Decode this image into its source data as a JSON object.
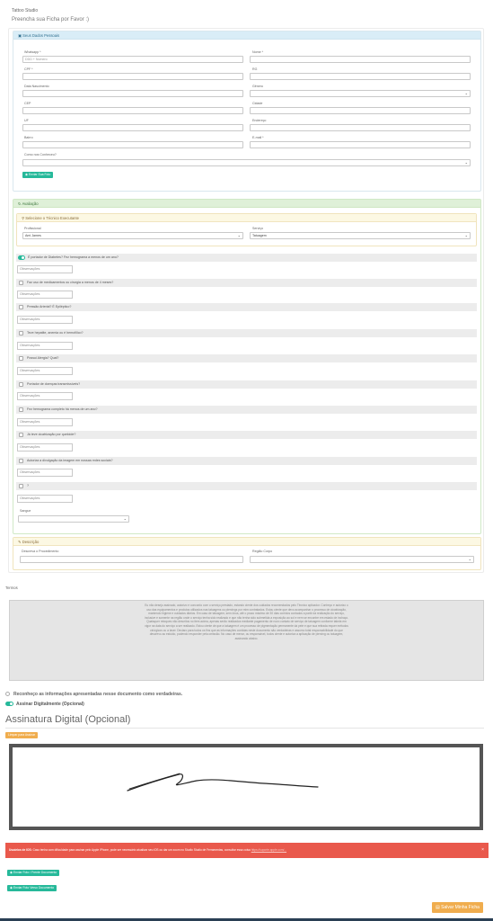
{
  "header": {
    "title": "Tattoo Studio",
    "subtitle": "Preencha sua Ficha por Favor :)"
  },
  "personal": {
    "heading": "Seus Dados Pessoais",
    "fields": {
      "whatsapp": {
        "label": "Whatsapp *",
        "placeholder": "DDD + Número"
      },
      "nome": {
        "label": "Nome *"
      },
      "cpf": {
        "label": "CPF *"
      },
      "rg": {
        "label": "RG"
      },
      "nascimento": {
        "label": "Data Nascimento"
      },
      "genero": {
        "label": "Gênero"
      },
      "cep": {
        "label": "CEP"
      },
      "cidade": {
        "label": "Cidade"
      },
      "uf": {
        "label": "UF"
      },
      "endereco": {
        "label": "Endereço"
      },
      "bairro": {
        "label": "Bairro"
      },
      "email": {
        "label": "E-mail *"
      },
      "conheceu": {
        "label": "Como nos Conheceu?"
      }
    },
    "send_photo": "Enviar Sua Foto"
  },
  "avaliacao": {
    "heading": "Avaliação",
    "sub_heading": "Selecione o Técnico Executante",
    "profissional": {
      "label": "Profissional",
      "value": "Ami James"
    },
    "servico": {
      "label": "Serviço",
      "value": "Tatuagem"
    },
    "obs_placeholder": "Observações",
    "questions": [
      "É portador de Diabetes? Fez hemograma a menos de um ano?",
      "Faz uso de medicamentos ou cirurgia a menos de 4 meses?",
      "Pressão Arterial? É Epiléptico?",
      "Teve hepatite, anemia ou é hemofílico?",
      "Possui Alergia? Qual?",
      "Portador de doenças transmissíveis?",
      "Fez hemograma completo há menos de um ano?",
      "Já teve cicatrização por queloide?",
      "Autoriza a divulgação da imagem em nossas redes sociais?",
      "?"
    ],
    "sangue": {
      "label": "Sangue"
    }
  },
  "descricao": {
    "heading": "Descrição",
    "desc_label": "Descreva o Procedimento",
    "regiao_label": "Região Corpo"
  },
  "termos": {
    "label": "Termos",
    "text": "Eu não desejo assinado, autorizo e concordo com o serviço prestado, estando ciente dos cuidados recomendados pelo Técnico aplicador. Conheço e autorizo o uso das equipamentos e produtos utilizados nas tatuagens ou piercings por mim contratados. Estou ciente que devo acompanhar o processo de cicatrização, mantendo higiene e cuidados diários. Em caso de tatuagem, sem ônus, até o prazo máximo de 30 dias corridos contados a partir da realização do serviço, inclusive e somente na região onde o serviço tenha sido realizado e que não tenha sido submetida a exposição ao sol e nem se encontre em estado de inchaço. Quaisquer retoques não descritos no item acima, apenas serão realizados mediante pagamento de novo contato de serviço de tatuagem conforme tabela em vigor na data do serviço a ser realizado. Estou ciente de que a tatuagem é um processo de pigmentação permanente da pele e que sua retirada requer métodos cirúrgicos ou a laser. Declaro para todos os fins que as informações contidas neste documento são verdadeiras e assumo total responsabilidade do que descrevo ao estúdio, podendo responder pela omissão. No caso de menor, ou responsável, todos ciente e autoriza a aplicação de piercing ou tatuagem, assinando abaixo."
  },
  "agree_text": "Reconheço as informações apresentadas nesse documento como verdadeiras.",
  "sign_toggle": "Assinar Digitalmente (Opcional)",
  "signature": {
    "title": "Assinatura Digital (Opcional)",
    "clear_button": "Limpar para Assinar"
  },
  "alert": {
    "bold": "Usuários de IOS:",
    "text": " Caso tenha com dificuldade para assinar pelo Apple iPhone, pode ser necessário atualizar seu iOS ou dar um zoom no Studio Studio de Ferramentas, consultar essa coisa",
    "link": "https://suporte.apple.com/..."
  },
  "buttons": {
    "send_id_front": "Enviar Foto / Frente Documento",
    "send_id_back": "Enviar Foto Verso Documento",
    "save": "Salvar Minha Ficha"
  },
  "colors": {
    "accent": "#26b99a",
    "warning": "#f0ad4e",
    "danger": "#e9594c",
    "info": "#d9edf7"
  }
}
